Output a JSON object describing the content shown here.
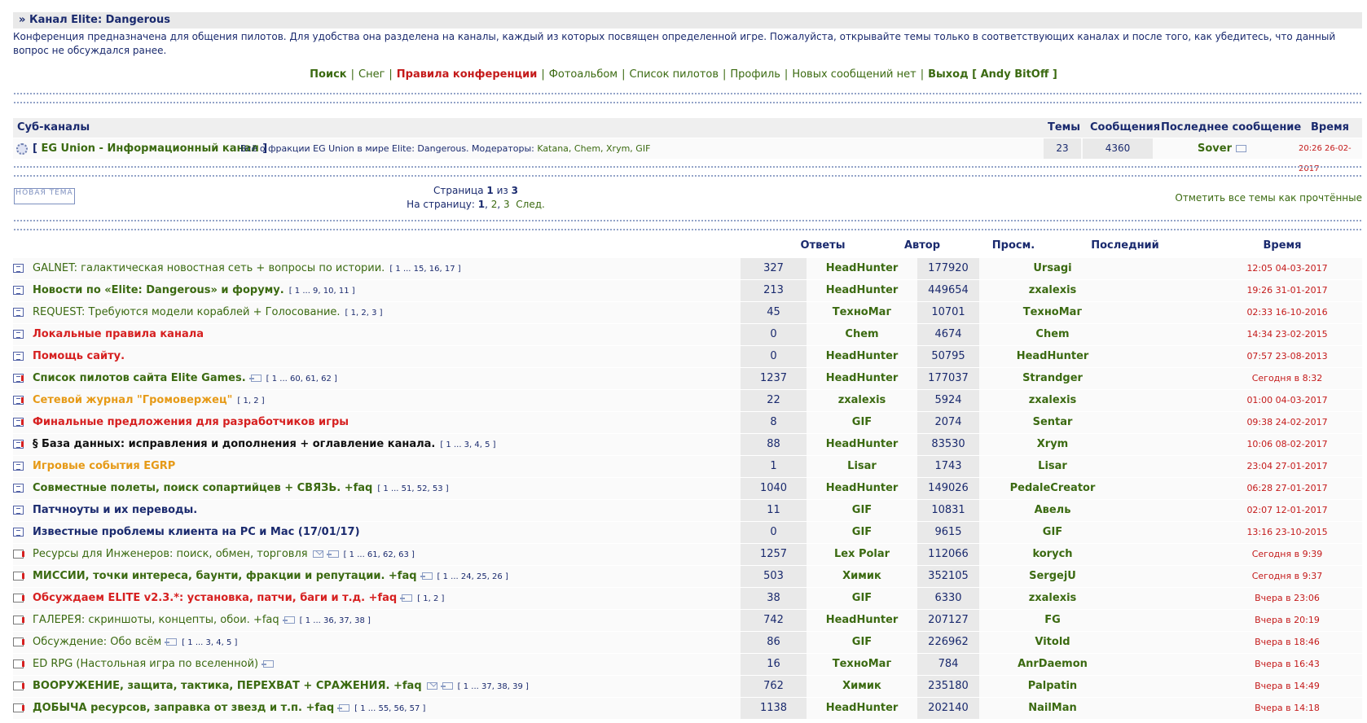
{
  "channel": {
    "title_prefix": "»",
    "title": "Канал Elite: Dangerous",
    "description": "Конференция предназначена для общения пилотов. Для удобства она разделена на каналы, каждый из которых посвящен определенной игре. Пожалуйста, открывайте темы только в соответствующих каналах и после того, как убедитесь, что данный вопрос не обсуждался ранее."
  },
  "nav": {
    "search": "Поиск",
    "snow": "Снег",
    "rules": "Правила конференции",
    "album": "Фотоальбом",
    "pilots": "Список пилотов",
    "profile": "Профиль",
    "no_new": "Новых сообщений нет",
    "logout": "Выход [ Andy BitOff ]"
  },
  "subchannels": {
    "headers": {
      "name": "Суб-каналы",
      "topics": "Темы",
      "posts": "Сообщения",
      "last": "Последнее сообщение",
      "time": "Время"
    },
    "row": {
      "bracket_open": "[",
      "name": "EG Union - Информационный канал",
      "bracket_close": "]",
      "desc": "Всё о фракции EG Union в мире Elite: Dangerous. Модераторы:",
      "mods": "Katana, Chem, Xrym, GIF",
      "topics": "23",
      "posts": "4360",
      "last": "Sover",
      "time": "20:26 26-02-2017"
    }
  },
  "new_topic_label": "НОВАЯ ТЕМА",
  "pager": {
    "page_label": "Страница",
    "current": "1",
    "of": "из",
    "total": "3",
    "to_page": "На страницу:",
    "p1": "1",
    "p2": "2",
    "p3": "3",
    "next": "След."
  },
  "mark_read": "Отметить все темы как прочтённые",
  "table_headers": {
    "replies": "Ответы",
    "author": "Автор",
    "views": "Просм.",
    "last": "Последний",
    "time": "Время"
  },
  "topics": [
    {
      "title": "GALNET: галактическая новостная сеть + вопросы по истории.",
      "style": "green",
      "icon": "normal",
      "pages": "[ 1 ... 15, 16, 17 ]",
      "replies": "327",
      "author": "HeadHunter",
      "views": "177920",
      "last": "Ursagi",
      "time": "12:05 04-03-2017"
    },
    {
      "title": "Новости по «Elite: Dangerous» и форуму.",
      "style": "gbold",
      "icon": "normal",
      "pages": "[ 1 ... 9, 10, 11 ]",
      "replies": "213",
      "author": "HeadHunter",
      "views": "449654",
      "last": "zxalexis",
      "time": "19:26 31-01-2017"
    },
    {
      "title": "REQUEST: Требуются модели кораблей + Голосование.",
      "style": "green",
      "icon": "normal",
      "pages": "[ 1, 2, 3 ]",
      "replies": "45",
      "author": "ТехноМаг",
      "views": "10701",
      "last": "ТехноМаг",
      "time": "02:33 16-10-2016"
    },
    {
      "title": "Локальные правила канала",
      "style": "red",
      "icon": "normal",
      "pages": "",
      "replies": "0",
      "author": "Chem",
      "views": "4674",
      "last": "Chem",
      "time": "14:34 23-02-2015"
    },
    {
      "title": "Помощь сайту.",
      "style": "red",
      "icon": "normal",
      "pages": "",
      "replies": "0",
      "author": "HeadHunter",
      "views": "50795",
      "last": "HeadHunter",
      "time": "07:57 23-08-2013"
    },
    {
      "title": "Список пилотов сайта Elite Games.",
      "style": "gbold",
      "icon": "hot",
      "go": true,
      "pages": "[ 1 ... 60, 61, 62 ]",
      "replies": "1237",
      "author": "HeadHunter",
      "views": "177037",
      "last": "Strandger",
      "time": "Сегодня в 8:32"
    },
    {
      "title": "Сетевой журнал \"Громовержец\"",
      "style": "orange",
      "icon": "hot",
      "pages": "[ 1, 2 ]",
      "replies": "22",
      "author": "zxalexis",
      "views": "5924",
      "last": "zxalexis",
      "time": "01:00 04-03-2017"
    },
    {
      "title": "Финальные предложения для разработчиков игры",
      "style": "red",
      "icon": "hot",
      "pages": "",
      "replies": "8",
      "author": "GIF",
      "views": "2074",
      "last": "Sentar",
      "time": "09:38 24-02-2017"
    },
    {
      "title": "§ База данных: исправления и дополнения + оглавление канала.",
      "style": "dkblk",
      "icon": "hot",
      "pages": "[ 1 ... 3, 4, 5 ]",
      "replies": "88",
      "author": "HeadHunter",
      "views": "83530",
      "last": "Xrym",
      "time": "10:06 08-02-2017"
    },
    {
      "title": "Игровые события EGRP",
      "style": "orange",
      "icon": "normal",
      "pages": "",
      "replies": "1",
      "author": "Lisar",
      "views": "1743",
      "last": "Lisar",
      "time": "23:04 27-01-2017"
    },
    {
      "title": "Совместные полеты, поиск сопартийцев + СВЯЗЬ. +faq",
      "style": "gbold",
      "icon": "normal",
      "pages": "[ 1 ... 51, 52, 53 ]",
      "replies": "1040",
      "author": "HeadHunter",
      "views": "149026",
      "last": "PedaleCreator",
      "time": "06:28 27-01-2017"
    },
    {
      "title": "Патчноуты и их переводы.",
      "style": "navy",
      "icon": "normal",
      "pages": "",
      "replies": "11",
      "author": "GIF",
      "views": "10831",
      "last": "Авель",
      "time": "02:07 12-01-2017"
    },
    {
      "title": "Известные проблемы клиента на PC и Mac (17/01/17)",
      "style": "navy",
      "icon": "normal",
      "pages": "",
      "replies": "0",
      "author": "GIF",
      "views": "9615",
      "last": "GIF",
      "time": "13:16 23-10-2015"
    },
    {
      "title": "Ресурсы для Инженеров: поиск, обмен, торговля",
      "style": "green",
      "icon": "new",
      "env": true,
      "go": true,
      "pages": "[ 1 ... 61, 62, 63 ]",
      "replies": "1257",
      "author": "Lex Polar",
      "views": "112066",
      "last": "korych",
      "time": "Сегодня в 9:39"
    },
    {
      "title": "МИССИИ, точки интереса, баунти, фракции и репутации. +faq",
      "style": "gbold",
      "icon": "new",
      "go": true,
      "pages": "[ 1 ... 24, 25, 26 ]",
      "replies": "503",
      "author": "Химик",
      "views": "352105",
      "last": "SergejU",
      "time": "Сегодня в 9:37"
    },
    {
      "title": "Обсуждаем ELITE v2.3.*: установка, патчи, баги и т.д. +faq",
      "style": "red",
      "icon": "new",
      "go": true,
      "pages": "[ 1, 2 ]",
      "replies": "38",
      "author": "GIF",
      "views": "6330",
      "last": "zxalexis",
      "time": "Вчера в 23:06"
    },
    {
      "title": "ГАЛЕРЕЯ: скриншоты, концепты, обои. +faq",
      "style": "green",
      "icon": "new",
      "go": true,
      "pages": "[ 1 ... 36, 37, 38 ]",
      "replies": "742",
      "author": "HeadHunter",
      "views": "207127",
      "last": "FG",
      "time": "Вчера в 20:19"
    },
    {
      "title": "Обсуждение: Обо всём",
      "style": "green",
      "icon": "new",
      "go": true,
      "pages": "[ 1 ... 3, 4, 5 ]",
      "replies": "86",
      "author": "GIF",
      "views": "226962",
      "last": "Vitold",
      "time": "Вчера в 18:46"
    },
    {
      "title": "ED RPG (Настольная игра по вселенной)",
      "style": "green",
      "icon": "new",
      "go": true,
      "pages": "",
      "replies": "16",
      "author": "ТехноМаг",
      "views": "784",
      "last": "AnrDaemon",
      "time": "Вчера в 16:43"
    },
    {
      "title": "ВООРУЖЕНИЕ, защита, тактика, ПЕРЕХВАТ + СРАЖЕНИЯ. +faq",
      "style": "gbold",
      "icon": "new",
      "env": true,
      "go": true,
      "pages": "[ 1 ... 37, 38, 39 ]",
      "replies": "762",
      "author": "Химик",
      "views": "235180",
      "last": "Palpatin",
      "time": "Вчера в 14:49"
    },
    {
      "title": "ДОБЫЧА ресурсов, заправка от звезд и т.п. +faq",
      "style": "gbold",
      "icon": "new",
      "go": true,
      "pages": "[ 1 ... 55, 56, 57 ]",
      "replies": "1138",
      "author": "HeadHunter",
      "views": "202140",
      "last": "NailMan",
      "time": "Вчера в 14:18"
    }
  ]
}
